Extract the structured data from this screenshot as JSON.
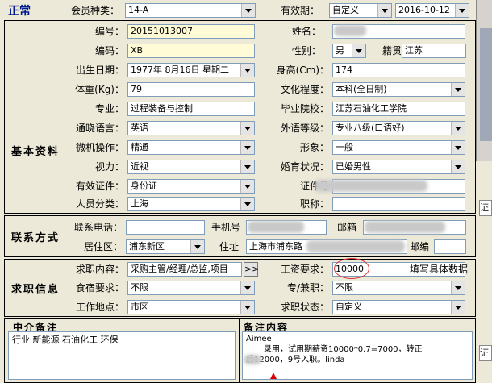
{
  "header": {
    "status": "正常",
    "member_type_label": "会员种类：",
    "member_type_value": "14-A",
    "validity_label": "有效期：",
    "validity_mode": "自定义",
    "validity_date": "2016-10-12"
  },
  "basic": {
    "section_title": "基本资料",
    "id_label": "编号：",
    "id_value": "20151013007",
    "name_label": "姓名：",
    "name_value": "",
    "code_label": "编码：",
    "code_value": "XB",
    "gender_label": "性别：",
    "gender_value": "男",
    "native_label": "籍贯",
    "native_value": "江苏",
    "birth_label": "出生日期：",
    "birth_value": "1977年 8月16日 星期二",
    "height_label": "身高(Cm)：",
    "height_value": "174",
    "weight_label": "体重(Kg)：",
    "weight_value": "79",
    "edu_label": "文化程度：",
    "edu_value": "本科(全日制)",
    "major_label": "专业：",
    "major_value": "过程装备与控制",
    "school_label": "毕业院校：",
    "school_value": "江苏石油化工学院",
    "lang_label": "通晓语言：",
    "lang_value": "英语",
    "lang_level_label": "外语等级：",
    "lang_level_value": "专业八级(口语好)",
    "pc_label": "微机操作：",
    "pc_value": "精通",
    "look_label": "形象：",
    "look_value": "一般",
    "vision_label": "视力：",
    "vision_value": "近视",
    "marital_label": "婚育状况：",
    "marital_value": "已婚男性",
    "cert_label": "有效证件：",
    "cert_value": "身份证",
    "cert_no_label": "证件号",
    "category_label": "人员分类：",
    "category_value": "上海",
    "title_label": "职称："
  },
  "contact": {
    "section_title": "联系方式",
    "phone_label": "联系电话：",
    "mobile_label": "手机号",
    "email_label": "邮箱",
    "district_label": "居住区：",
    "district_value": "浦东新区",
    "address_label": "住址",
    "address_value": "上海市浦东路",
    "postcode_label": "邮编"
  },
  "job": {
    "section_title": "求职信息",
    "content_label": "求职内容：",
    "content_value": "采购主管/经理/总监,项目",
    "more_button": ">>",
    "salary_label": "工资要求：",
    "salary_value": "10000",
    "salary_hint": "填写具体数据",
    "housing_label": "食宿要求：",
    "housing_value": "不限",
    "type_label": "专/兼职：",
    "type_value": "不限",
    "location_label": "工作地点：",
    "location_value": "市区",
    "status_label": "求职状态：",
    "status_value": "自定义"
  },
  "notes": {
    "agent_title": "中介备注",
    "agent_text": "行业 新能源 石油化工 环保",
    "remark_title": "备注内容",
    "remark_line1": "Aimee",
    "remark_line2": "录用，试用期薪资10000*0.7=7000，转正",
    "remark_line3": "后12000，9号入职。linda"
  },
  "side": {
    "tab_label": "证",
    "btn_label": "证"
  }
}
